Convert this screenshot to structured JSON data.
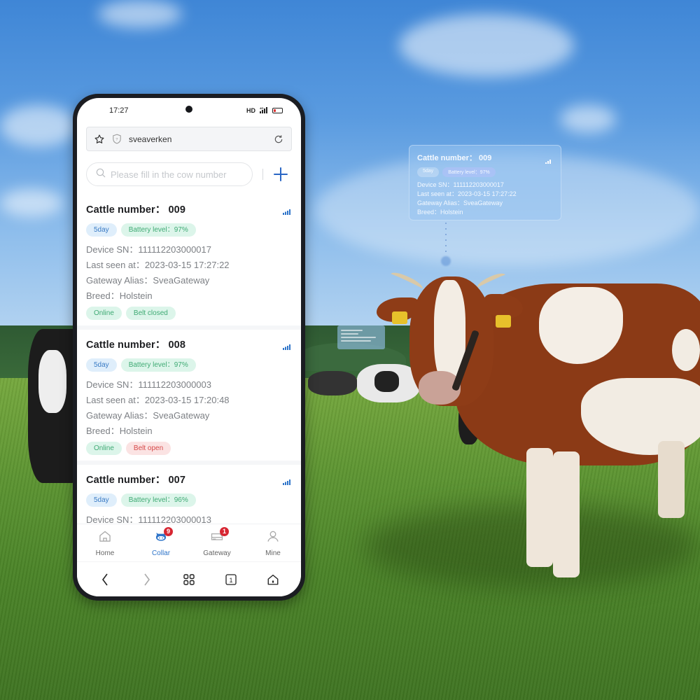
{
  "status_bar": {
    "time": "17:27",
    "network": "HD",
    "signal_icon": "signal-4g-icon",
    "battery_icon": "battery-low-icon"
  },
  "browser": {
    "url_text": "sveaverken",
    "icons": [
      "star-icon",
      "shield-icon",
      "refresh-icon"
    ]
  },
  "search": {
    "placeholder": "Please fill in the cow number",
    "value": "",
    "add_icon": "plus-icon"
  },
  "cattle": [
    {
      "title": "Cattle number： 009",
      "day_tag": "5day",
      "battery_tag": "Battery level：97%",
      "device_sn": "Device SN：111112203000017",
      "last_seen": "Last seen at：2023-03-15 17:27:22",
      "gateway": "Gateway Alias：SveaGateway",
      "breed": "Breed：Holstein",
      "online_tag": "Online",
      "belt_tag": "Belt closed",
      "belt_state": "closed"
    },
    {
      "title": "Cattle number： 008",
      "day_tag": "5day",
      "battery_tag": "Battery level：97%",
      "device_sn": "Device SN：111112203000003",
      "last_seen": "Last seen at：2023-03-15 17:20:48",
      "gateway": "Gateway Alias：SveaGateway",
      "breed": "Breed：Holstein",
      "online_tag": "Online",
      "belt_tag": "Belt open",
      "belt_state": "open"
    },
    {
      "title": "Cattle number： 007",
      "day_tag": "5day",
      "battery_tag": "Battery level：96%",
      "device_sn": "Device SN：111112203000013"
    }
  ],
  "tabbar": {
    "tabs": [
      {
        "label": "Home",
        "icon": "home-icon",
        "active": false
      },
      {
        "label": "Collar",
        "icon": "cow-collar-icon",
        "active": true,
        "badge": "9"
      },
      {
        "label": "Gateway",
        "icon": "gateway-icon",
        "active": false,
        "badge": "1"
      },
      {
        "label": "Mine",
        "icon": "user-icon",
        "active": false
      }
    ]
  },
  "navbar": {
    "buttons": [
      "back-icon",
      "forward-icon",
      "apps-grid-icon",
      "tabs-count-icon",
      "home-icon"
    ],
    "tabs_count": "1"
  },
  "floating_card": {
    "title": "Cattle number： 009",
    "day_tag": "5day",
    "battery_tag": "Battery level：97%",
    "device_sn": "Device SN：111112203000017",
    "last_seen": "Last seen at：2023-03-15 17:27:22",
    "gateway": "Gateway Alias：SveaGateway",
    "breed": "Breed：Holstein"
  },
  "colors": {
    "accent": "#2e74c9",
    "online_green": "#3faa74",
    "belt_open_red": "#d64a4a",
    "badge_red": "#d72632"
  }
}
